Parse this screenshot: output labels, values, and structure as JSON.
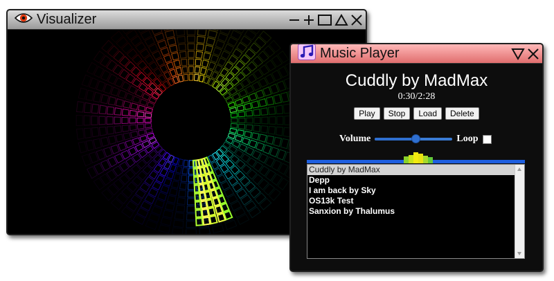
{
  "visualizer": {
    "title": "Visualizer",
    "icon": "eye-icon"
  },
  "player": {
    "title": "Music Player",
    "icon": "music-note-icon",
    "now_playing": "Cuddly by MadMax",
    "time": "0:30/2:28",
    "buttons": {
      "play": "Play",
      "stop": "Stop",
      "load": "Load",
      "delete": "Delete"
    },
    "volume_label": "Volume",
    "volume_level": 0.52,
    "loop_label": "Loop",
    "loop_checked": false,
    "playlist": [
      "Cuddly by MadMax",
      "Depp",
      "I am back by Sky",
      "OS13k Test",
      "Sanxion by Thalumus"
    ],
    "selected_index": 0
  },
  "colors": {
    "player_titlebar": "#f08080",
    "visualizer_titlebar": "#bdbdbd",
    "slider": "#2f6fd0"
  }
}
